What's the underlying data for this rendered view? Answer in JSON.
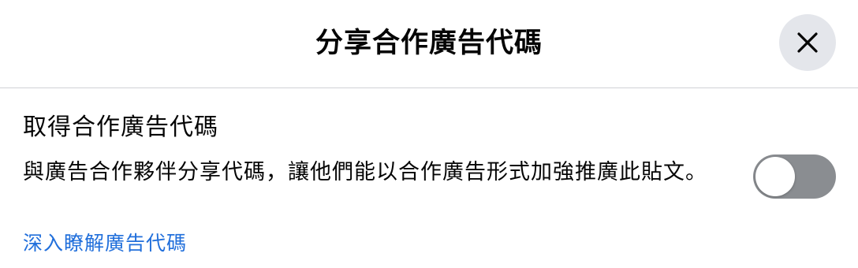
{
  "header": {
    "title": "分享合作廣告代碼",
    "close_icon": "close-icon"
  },
  "section": {
    "title": "取得合作廣告代碼",
    "description": "與廣告合作夥伴分享代碼，讓他們能以合作廣告形式加強推廣此貼文。",
    "learn_more_link": "深入瞭解廣告代碼",
    "toggle": {
      "state": "off"
    }
  },
  "colors": {
    "link": "#216fdb",
    "toggle_off": "#8a8d91",
    "close_button_bg": "#e4e6eb",
    "text": "#050505"
  }
}
